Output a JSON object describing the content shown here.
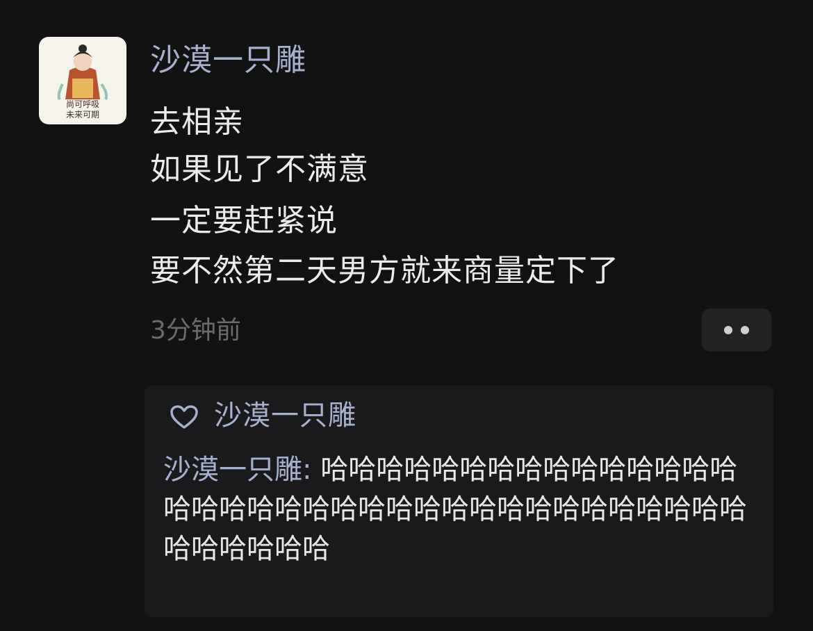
{
  "avatar": {
    "caption": "尚可呼吸\n未来可期",
    "colors": {
      "background": "#f6f3ea",
      "robe": "#b8552e",
      "scarf": "#8fc4b8"
    }
  },
  "post": {
    "author": "沙漠一只雕",
    "lines": [
      "去相亲",
      "如果见了不满意",
      "一定要赶紧说",
      "要不然第二天男方就来商量定下了"
    ],
    "timestamp": "3分钟前"
  },
  "more_button": {
    "icon": "more-dots-icon"
  },
  "reply_box": {
    "likes": {
      "icon": "heart-outline-icon",
      "names": "沙漠一只雕"
    },
    "comment": {
      "commenter": "沙漠一只雕",
      "separator": ": ",
      "text": "哈哈哈哈哈哈哈哈哈哈哈哈哈哈哈哈哈哈哈哈哈哈哈哈哈哈哈哈哈哈哈哈哈哈哈哈哈哈哈哈哈哈"
    }
  },
  "colors": {
    "background": "#121212",
    "name_blue": "#a6b0cf",
    "text": "#ececec",
    "muted": "#6b6b6b",
    "panel": "#1a1a1c"
  }
}
